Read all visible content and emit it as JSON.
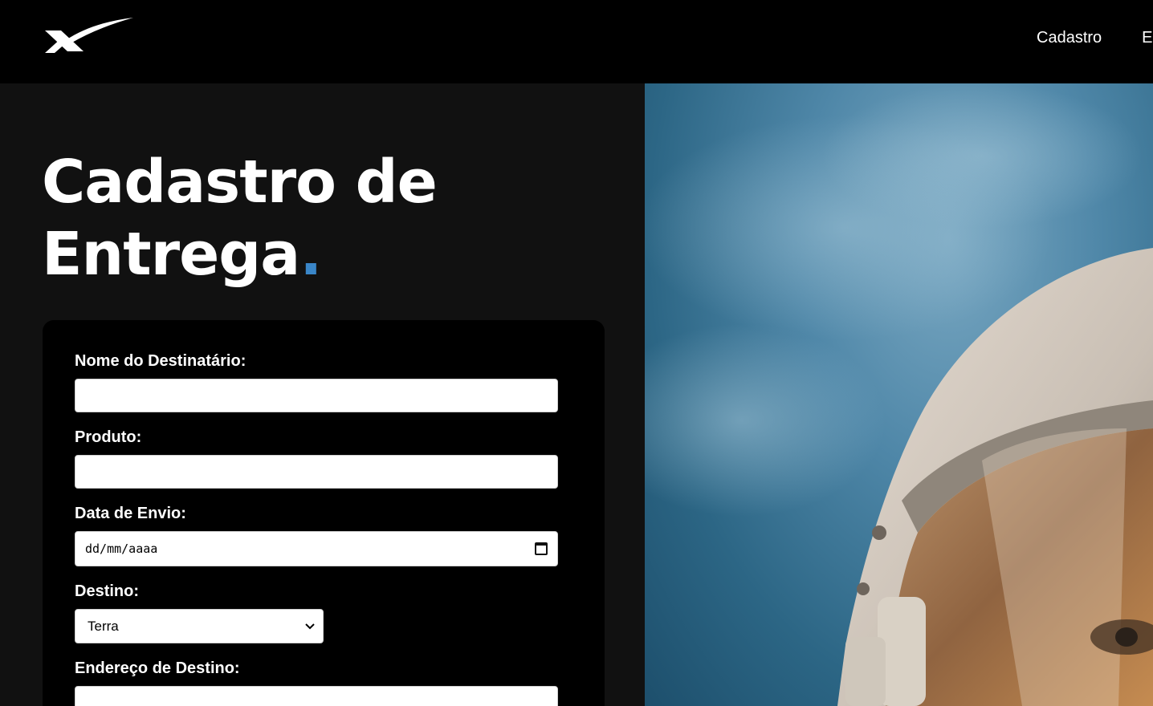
{
  "header": {
    "logo_icon": "x-swoosh-logo-icon",
    "nav": [
      {
        "label": "Cadastro"
      },
      {
        "label": "E"
      }
    ]
  },
  "hero": {
    "title_line1": "Cadastro de",
    "title_line2": "Entrega",
    "title_dot": ".",
    "accent_color": "#3a86c8"
  },
  "form": {
    "recipient_label": "Nome do Destinatário:",
    "recipient_value": "",
    "product_label": "Produto:",
    "product_value": "",
    "date_label": "Data de Envio:",
    "date_placeholder": "dd/mm/aaaa",
    "date_icon": "calendar-icon",
    "destination_label": "Destino:",
    "destination_selected": "Terra",
    "address_label": "Endereço de Destino:",
    "address_value": ""
  },
  "image": {
    "subject": "astronaut-helmet-photo"
  }
}
